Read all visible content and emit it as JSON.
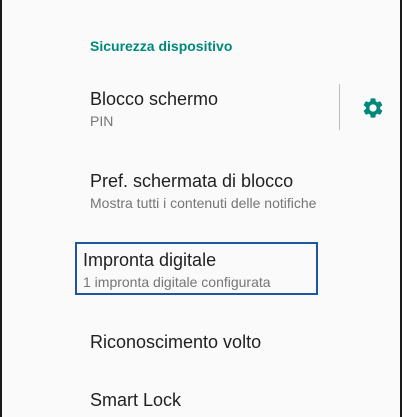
{
  "section": {
    "title": "Sicurezza dispositivo"
  },
  "items": [
    {
      "title": "Blocco schermo",
      "summary": "PIN"
    },
    {
      "title": "Pref. schermata di blocco",
      "summary": "Mostra tutti i contenuti delle notifiche"
    },
    {
      "title": "Impronta digitale",
      "summary": "1 impronta digitale configurata"
    },
    {
      "title": "Riconoscimento volto"
    },
    {
      "title": "Smart Lock"
    }
  ],
  "icons": {
    "settings": "gear-icon"
  },
  "colors": {
    "accent": "#00897b",
    "highlight": "#1e56a0",
    "text_primary": "#212121",
    "text_secondary": "#757575"
  }
}
